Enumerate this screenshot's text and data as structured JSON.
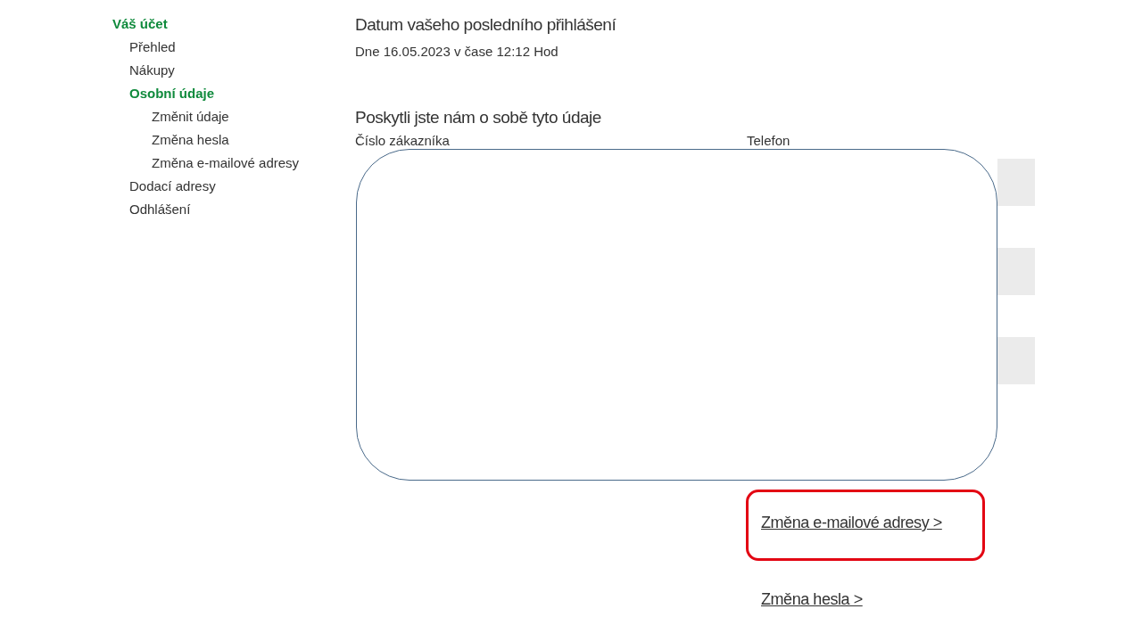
{
  "sidebar": {
    "title": "Váš účet",
    "items": [
      {
        "label": "Přehled",
        "selected": false
      },
      {
        "label": "Nákupy",
        "selected": false
      },
      {
        "label": "Osobní údaje",
        "selected": true,
        "children": [
          {
            "label": "Změnit údaje",
            "selected": false
          },
          {
            "label": "Změna hesla",
            "selected": false
          },
          {
            "label": "Změna e-mailové adresy",
            "selected": false
          }
        ]
      },
      {
        "label": "Dodací adresy",
        "selected": false
      },
      {
        "label": "Odhlášení",
        "selected": false
      }
    ]
  },
  "last_login": {
    "heading": "Datum vašeho posledního přihlášení",
    "text": "Dne 16.05.2023 v čase 12:12 Hod"
  },
  "profile": {
    "heading": "Poskytli jste nám o sobě tyto údaje",
    "fields": [
      {
        "label": "Číslo zákazníka"
      },
      {
        "label": "Telefon"
      }
    ]
  },
  "links": [
    {
      "label": "Změna e-mailové adresy >",
      "highlighted": true
    },
    {
      "label": "Změna hesla >",
      "highlighted": false
    }
  ]
}
